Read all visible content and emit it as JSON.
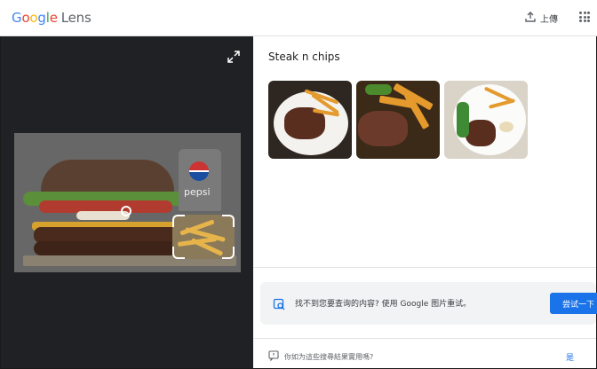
{
  "app": {
    "logo_text": "Google",
    "product": "Lens"
  },
  "header": {
    "upload_label": "上傳",
    "icons": [
      "upload-icon",
      "apps-grid-icon"
    ]
  },
  "image_pane": {
    "icons": [
      "expand-icon"
    ],
    "product_visible_text": "pepsi"
  },
  "results": {
    "title": "Steak n chips",
    "thumbnails": [
      {
        "name": "steak-fries-plate-1"
      },
      {
        "name": "steak-wedges-board"
      },
      {
        "name": "steak-greens-plate"
      }
    ]
  },
  "not_found": {
    "text": "找不到您要查询的内容? 使用 Google 图片重试。",
    "button_label": "尝试一下"
  },
  "feedback": {
    "question": "你如为這些搜尋結果實用嗎?",
    "yes_label": "是"
  },
  "colors": {
    "accent": "#1a73e8",
    "dark_pane": "#202124"
  }
}
